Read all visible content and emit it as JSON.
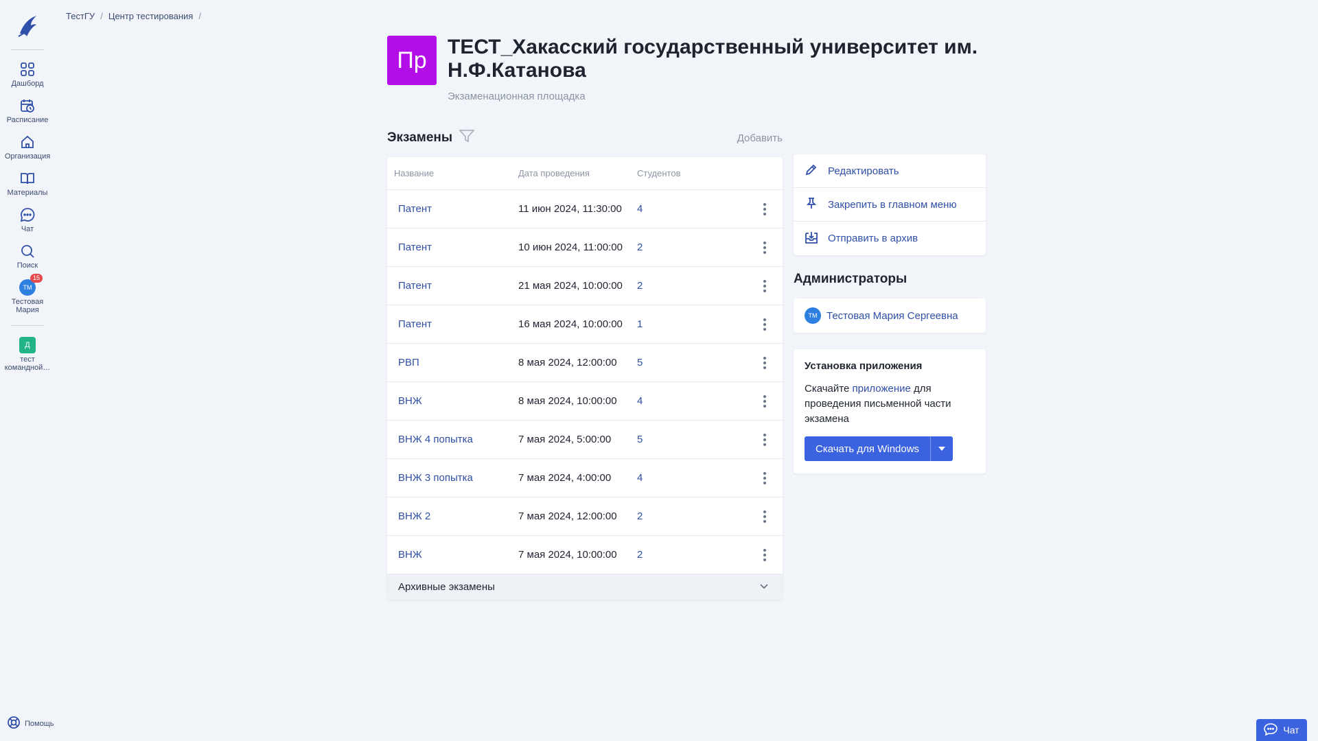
{
  "sidebar": {
    "items": [
      {
        "label": "Дашборд"
      },
      {
        "label": "Расписание"
      },
      {
        "label": "Организация"
      },
      {
        "label": "Материалы"
      },
      {
        "label": "Чат"
      },
      {
        "label": "Поиск"
      }
    ],
    "user": {
      "initials": "ТМ",
      "badge": "15",
      "label": "Тестовая Мария"
    },
    "team": {
      "initial": "Д",
      "label": "тест командной…"
    },
    "help": "Помощь"
  },
  "breadcrumb": [
    "ТестГУ",
    "Центр тестирования"
  ],
  "org": {
    "logo_text": "Пр",
    "title": "ТЕСТ_Хакасский государственный университет им. Н.Ф.Катанова",
    "subtitle": "Экзаменационная площадка",
    "logo_color": "#b40ee8"
  },
  "exams": {
    "title": "Экзамены",
    "add_label": "Добавить",
    "columns": [
      "Название",
      "Дата проведения",
      "Студентов"
    ],
    "rows": [
      {
        "name": "Патент",
        "date": "11 июн 2024, 11:30:00",
        "students": "4"
      },
      {
        "name": "Патент",
        "date": "10 июн 2024, 11:00:00",
        "students": "2"
      },
      {
        "name": "Патент",
        "date": "21 мая 2024, 10:00:00",
        "students": "2"
      },
      {
        "name": "Патент",
        "date": "16 мая 2024, 10:00:00",
        "students": "1"
      },
      {
        "name": "РВП",
        "date": "8 мая 2024, 12:00:00",
        "students": "5"
      },
      {
        "name": "ВНЖ",
        "date": "8 мая 2024, 10:00:00",
        "students": "4"
      },
      {
        "name": "ВНЖ 4 попытка",
        "date": "7 мая 2024, 5:00:00",
        "students": "5"
      },
      {
        "name": "ВНЖ 3 попытка",
        "date": "7 мая 2024, 4:00:00",
        "students": "4"
      },
      {
        "name": "ВНЖ 2",
        "date": "7 мая 2024, 12:00:00",
        "students": "2"
      },
      {
        "name": "ВНЖ",
        "date": "7 мая 2024, 10:00:00",
        "students": "2"
      }
    ],
    "archive_label": "Архивные экзамены"
  },
  "actions": {
    "edit": "Редактировать",
    "pin": "Закрепить в главном меню",
    "archive": "Отправить в архив"
  },
  "admins": {
    "title": "Администраторы",
    "list": [
      {
        "initials": "ТМ",
        "name": "Тестовая Мария Сергеевна"
      }
    ]
  },
  "install": {
    "title": "Установка приложения",
    "text_before": "Скачайте ",
    "link": "приложение",
    "text_after": " для проведения письменной части экзамена",
    "button": "Скачать для Windows"
  },
  "chat_button": "Чат",
  "colors": {
    "accent": "#3b63e0",
    "link": "#2f4fa8",
    "badge": "#e5484d"
  }
}
